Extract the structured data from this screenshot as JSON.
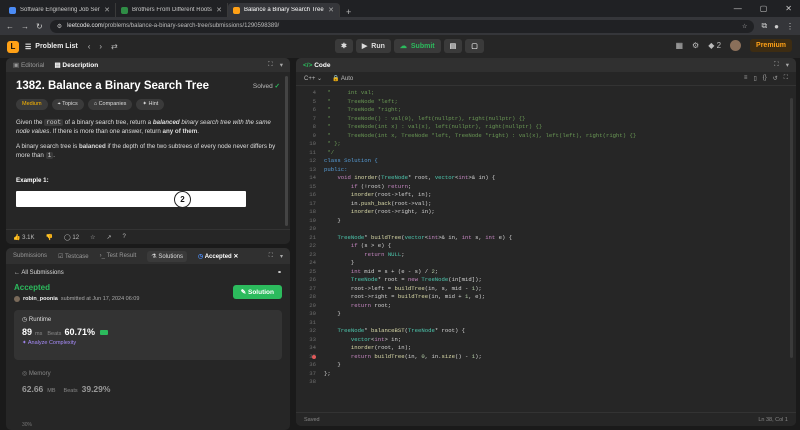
{
  "browser": {
    "tabs": [
      {
        "title": "Software Engineering Job Seri...",
        "color": "#4b8bf5",
        "active": false
      },
      {
        "title": "Brothers From Different Roots",
        "color": "#2f8d46",
        "active": false
      },
      {
        "title": "Balance a Binary Search Tree -",
        "color": "#ffa116",
        "active": true
      }
    ],
    "new_tab": "+",
    "url_host": "leetcode.com",
    "url_path": "/problems/balance-a-binary-search-tree/submissions/1290598389/"
  },
  "nav": {
    "problem_list": "Problem List",
    "run": "Run",
    "submit": "Submit",
    "streak": "2",
    "premium": "Premium"
  },
  "description": {
    "tab_editorial": "Editorial",
    "tab_description": "Description",
    "title": "1382. Balance a Binary Search Tree",
    "solved": "Solved",
    "tags": [
      "Medium",
      "Topics",
      "Companies",
      "Hint"
    ],
    "para1_a": "Given the ",
    "para1_code": "root",
    "para1_b": " of a binary search tree, return a ",
    "para1_bold": "balanced",
    "para1_c": " binary search tree with the same node values",
    "para1_d": ". If there is more than one answer, return ",
    "para1_any": "any of them",
    "para1_e": ".",
    "para2_a": "A binary search tree is ",
    "para2_bold": "balanced",
    "para2_b": " if the depth of the two subtrees of every node never differs by more than ",
    "para2_code": "1",
    "para2_c": ".",
    "example_title": "Example 1:",
    "example_node": "2",
    "likes": "3.1K",
    "comments": "12"
  },
  "submission": {
    "tabs": [
      "Submissions",
      "Testcase",
      "Test Result",
      "Solutions",
      "Accepted"
    ],
    "all_submissions": "All Submissions",
    "status": "Accepted",
    "user": "robin_poonia",
    "submitted_on": "submitted at Jun 17, 2024 06:09",
    "solution_btn": "Solution",
    "runtime_label": "Runtime",
    "runtime_value": "89",
    "runtime_unit": "ms",
    "beats_label": "Beats",
    "runtime_beats": "60.71%",
    "analyze": "Analyze Complexity",
    "memory_label": "Memory",
    "memory_value": "62.66",
    "memory_unit": "MB",
    "memory_beats": "39.29%",
    "footer_pct": "30%"
  },
  "editor": {
    "header": "Code",
    "language": "C++",
    "auto": "Auto",
    "status_left": "Saved",
    "status_right": "Ln 38, Col 1",
    "lines": [
      {
        "n": "4",
        "t": " *     int val;",
        "k": "c"
      },
      {
        "n": "5",
        "t": " *     TreeNode *left;",
        "k": "c"
      },
      {
        "n": "6",
        "t": " *     TreeNode *right;",
        "k": "c"
      },
      {
        "n": "7",
        "t": " *     TreeNode() : val(0), left(nullptr), right(nullptr) {}",
        "k": "c"
      },
      {
        "n": "8",
        "t": " *     TreeNode(int x) : val(x), left(nullptr), right(nullptr) {}",
        "k": "c"
      },
      {
        "n": "9",
        "t": " *     TreeNode(int x, TreeNode *left, TreeNode *right) : val(x), left(left), right(right) {}",
        "k": "c"
      },
      {
        "n": "10",
        "t": " * };",
        "k": "c"
      },
      {
        "n": "11",
        "t": " */",
        "k": "c"
      },
      {
        "n": "12",
        "t": "class Solution {",
        "k": "k"
      },
      {
        "n": "13",
        "t": "public:",
        "k": "k"
      },
      {
        "n": "14",
        "t": "    void inorder(TreeNode* root, vector<int>& in) {",
        "k": ""
      },
      {
        "n": "15",
        "t": "        if (!root) return;",
        "k": ""
      },
      {
        "n": "16",
        "t": "        inorder(root->left, in);",
        "k": ""
      },
      {
        "n": "17",
        "t": "        in.push_back(root->val);",
        "k": ""
      },
      {
        "n": "18",
        "t": "        inorder(root->right, in);",
        "k": ""
      },
      {
        "n": "19",
        "t": "    }",
        "k": ""
      },
      {
        "n": "20",
        "t": "",
        "k": ""
      },
      {
        "n": "21",
        "t": "    TreeNode* buildTree(vector<int>& in, int s, int e) {",
        "k": ""
      },
      {
        "n": "22",
        "t": "        if (s > e) {",
        "k": ""
      },
      {
        "n": "23",
        "t": "            return NULL;",
        "k": ""
      },
      {
        "n": "24",
        "t": "        }",
        "k": ""
      },
      {
        "n": "25",
        "t": "        int mid = s + (e - s) / 2;",
        "k": ""
      },
      {
        "n": "26",
        "t": "        TreeNode* root = new TreeNode(in[mid]);",
        "k": ""
      },
      {
        "n": "27",
        "t": "        root->left = buildTree(in, s, mid - 1);",
        "k": ""
      },
      {
        "n": "28",
        "t": "        root->right = buildTree(in, mid + 1, e);",
        "k": ""
      },
      {
        "n": "29",
        "t": "        return root;",
        "k": ""
      },
      {
        "n": "30",
        "t": "    }",
        "k": ""
      },
      {
        "n": "31",
        "t": "",
        "k": ""
      },
      {
        "n": "32",
        "t": "    TreeNode* balanceBST(TreeNode* root) {",
        "k": ""
      },
      {
        "n": "33",
        "t": "        vector<int> in;",
        "k": ""
      },
      {
        "n": "34",
        "t": "        inorder(root, in);",
        "k": ""
      },
      {
        "n": "35",
        "t": "        return buildTree(in, 0, in.size() - 1);",
        "k": ""
      },
      {
        "n": "36",
        "t": "    }",
        "k": ""
      },
      {
        "n": "37",
        "t": "};",
        "k": ""
      },
      {
        "n": "38",
        "t": "",
        "k": ""
      }
    ]
  }
}
